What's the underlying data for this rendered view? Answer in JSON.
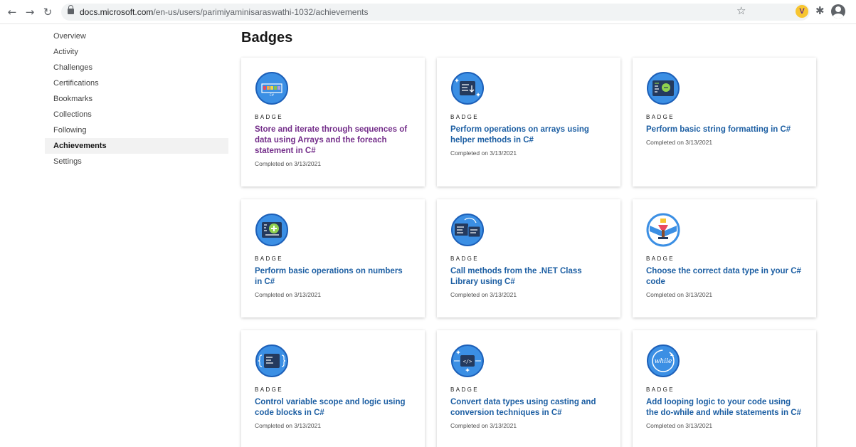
{
  "browser": {
    "url_host": "docs.microsoft.com",
    "url_path": "/en-us/users/parimiyaminisaraswathi-1032/achievements",
    "extension_letter": "V"
  },
  "sidebar": {
    "items": [
      {
        "label": "Overview"
      },
      {
        "label": "Activity"
      },
      {
        "label": "Challenges"
      },
      {
        "label": "Certifications"
      },
      {
        "label": "Bookmarks"
      },
      {
        "label": "Collections"
      },
      {
        "label": "Following"
      },
      {
        "label": "Achievements",
        "active": true
      },
      {
        "label": "Settings"
      }
    ]
  },
  "main": {
    "title": "Badges",
    "cards": [
      {
        "label": "BADGE",
        "title": "Store and iterate through sequences of data using Arrays and the foreach statement in C#",
        "date": "Completed on 3/13/2021",
        "icon": "arrays-badge-icon"
      },
      {
        "label": "BADGE",
        "title": "Perform operations on arrays using helper methods in C#",
        "date": "Completed on 3/13/2021",
        "icon": "array-helpers-badge-icon"
      },
      {
        "label": "BADGE",
        "title": "Perform basic string formatting in C#",
        "date": "Completed on 3/13/2021",
        "icon": "string-format-badge-icon"
      },
      {
        "label": "BADGE",
        "title": "Perform basic operations on numbers in C#",
        "date": "Completed on 3/13/2021",
        "icon": "numbers-badge-icon"
      },
      {
        "label": "BADGE",
        "title": "Call methods from the .NET Class Library using C#",
        "date": "Completed on 3/13/2021",
        "icon": "class-library-badge-icon"
      },
      {
        "label": "BADGE",
        "title": "Choose the correct data type in your C# code",
        "date": "Completed on 3/13/2021",
        "icon": "data-type-badge-icon"
      },
      {
        "label": "BADGE",
        "title": "Control variable scope and logic using code blocks in C#",
        "date": "Completed on 3/13/2021",
        "icon": "code-blocks-badge-icon"
      },
      {
        "label": "BADGE",
        "title": "Convert data types using casting and conversion techniques in C#",
        "date": "Completed on 3/13/2021",
        "icon": "casting-badge-icon",
        "icon_text": "</>"
      },
      {
        "label": "BADGE",
        "title": "Add looping logic to your code using the do-while and while statements in C#",
        "date": "Completed on 3/13/2021",
        "icon": "while-loop-badge-icon",
        "icon_text": "while"
      }
    ]
  },
  "colors": {
    "link": "#1d5fa3",
    "visited_link": "#742e8a",
    "badge_blue": "#3b8fe4",
    "badge_dark": "#243a5e"
  }
}
